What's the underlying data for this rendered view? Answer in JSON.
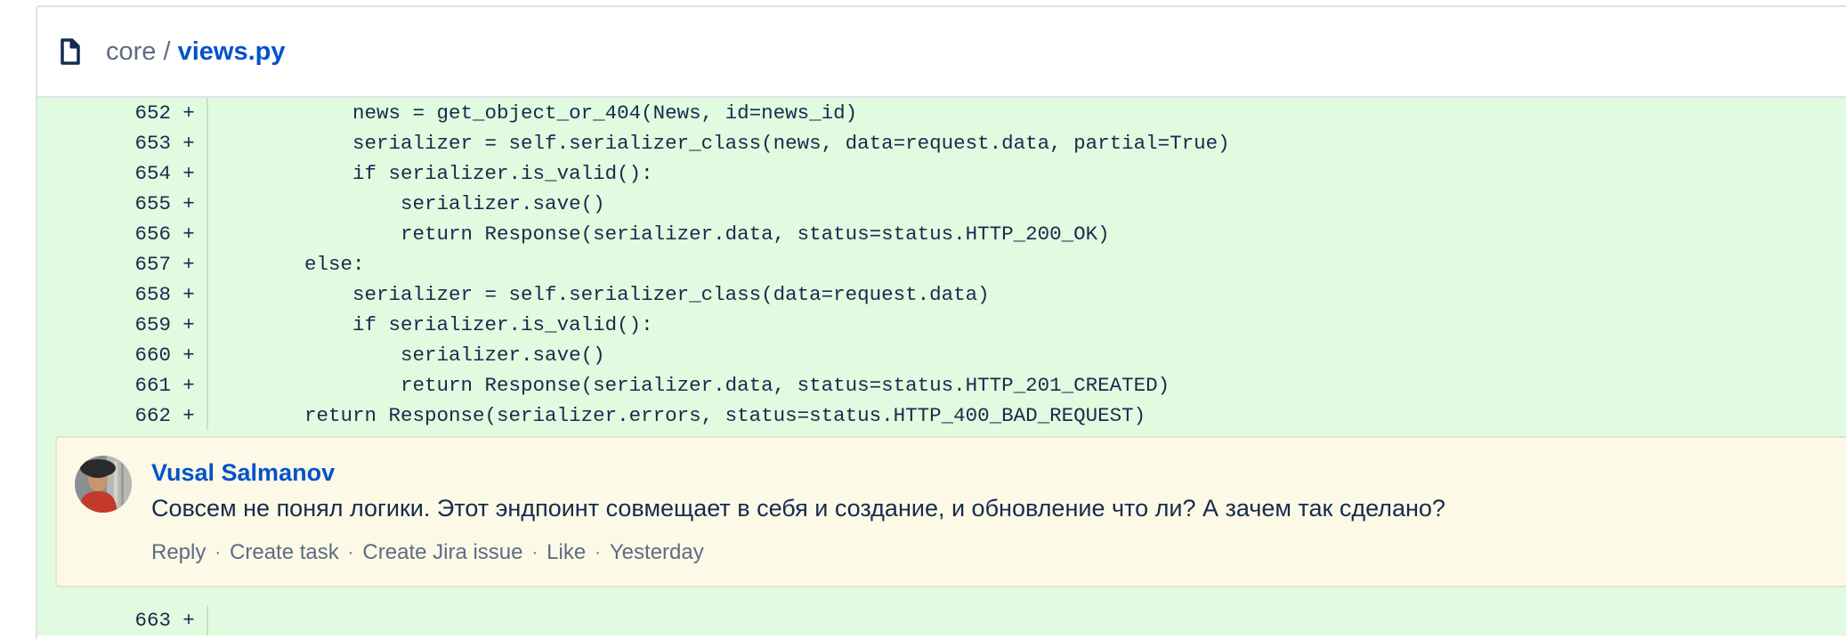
{
  "file": {
    "dir": "core",
    "separator": "/",
    "name": "views.py"
  },
  "diff_lines": [
    {
      "num": "652",
      "sign": "+",
      "code": "            news = get_object_or_404(News, id=news_id)"
    },
    {
      "num": "653",
      "sign": "+",
      "code": "            serializer = self.serializer_class(news, data=request.data, partial=True)"
    },
    {
      "num": "654",
      "sign": "+",
      "code": "            if serializer.is_valid():"
    },
    {
      "num": "655",
      "sign": "+",
      "code": "                serializer.save()"
    },
    {
      "num": "656",
      "sign": "+",
      "code": "                return Response(serializer.data, status=status.HTTP_200_OK)"
    },
    {
      "num": "657",
      "sign": "+",
      "code": "        else:"
    },
    {
      "num": "658",
      "sign": "+",
      "code": "            serializer = self.serializer_class(data=request.data)"
    },
    {
      "num": "659",
      "sign": "+",
      "code": "            if serializer.is_valid():"
    },
    {
      "num": "660",
      "sign": "+",
      "code": "                serializer.save()"
    },
    {
      "num": "661",
      "sign": "+",
      "code": "                return Response(serializer.data, status=status.HTTP_201_CREATED)"
    },
    {
      "num": "662",
      "sign": "+",
      "code": "        return Response(serializer.errors, status=status.HTTP_400_BAD_REQUEST)"
    }
  ],
  "comment": {
    "author": "Vusal Salmanov",
    "text": "Совсем не понял логики. Этот эндпоинт совмещает в себя и создание, и обновление что ли? А зачем так сделано?",
    "actions": {
      "reply": "Reply",
      "create_task": "Create task",
      "create_jira": "Create Jira issue",
      "like": "Like",
      "time": "Yesterday"
    },
    "separator": "·"
  },
  "trailing_line": {
    "num": "663",
    "sign": "+"
  },
  "colors": {
    "added_bg": "#e0fbdf",
    "comment_bg": "#fcf9e7",
    "link": "#0052cc",
    "muted": "#5e6c84",
    "text": "#172b4d"
  },
  "icons": {
    "file": "file-icon",
    "avatar": "user-avatar"
  }
}
